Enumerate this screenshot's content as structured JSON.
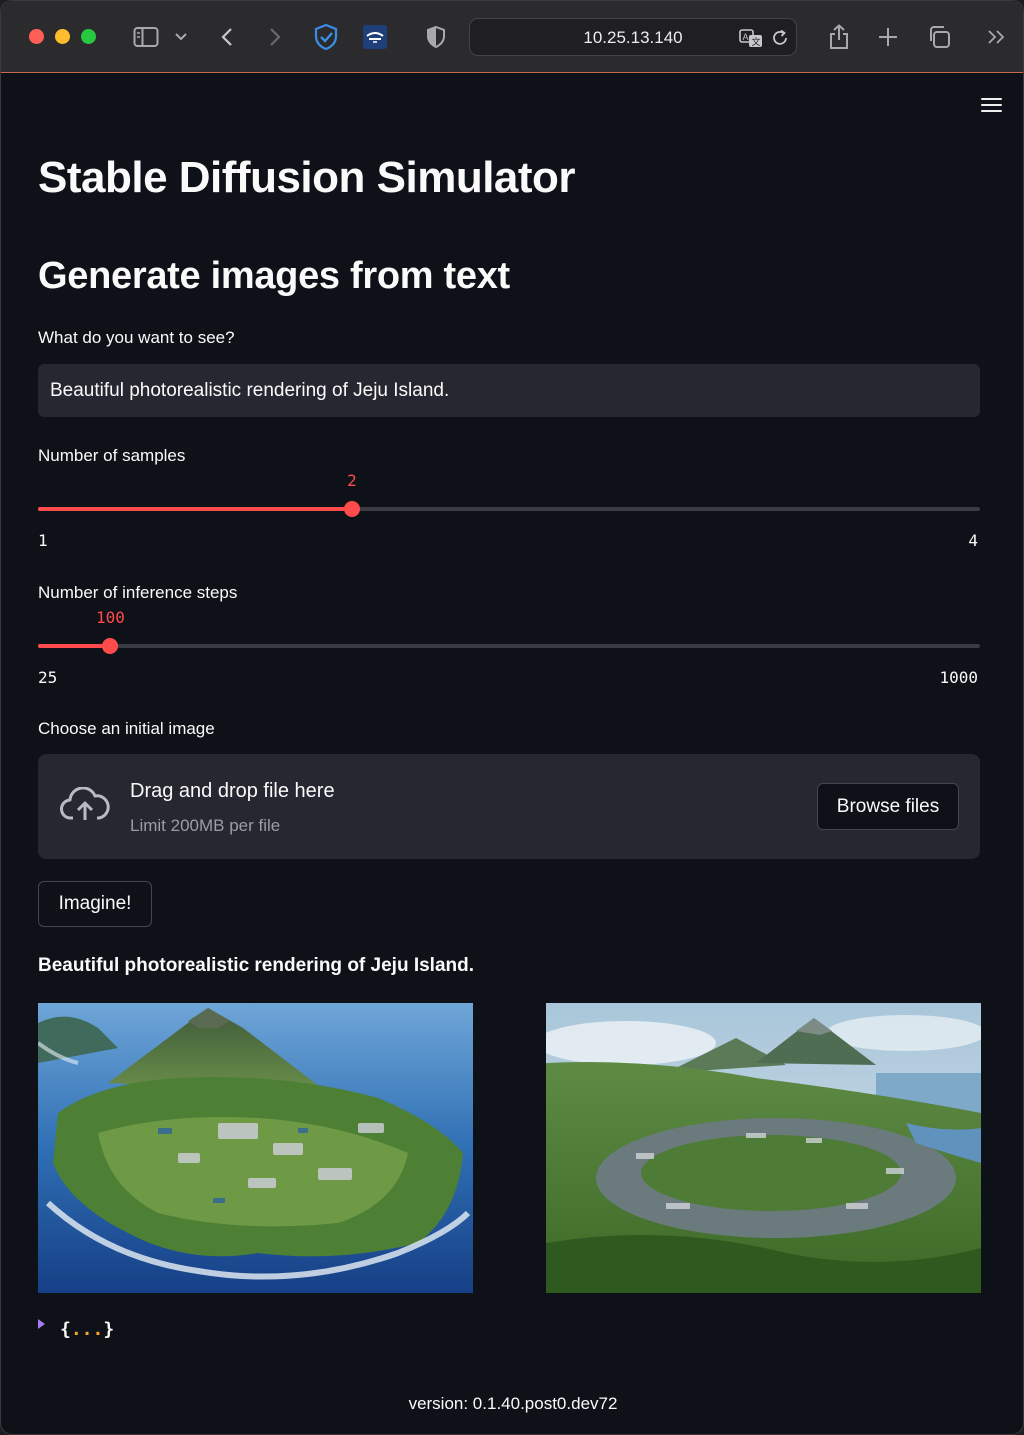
{
  "browser": {
    "url": "10.25.13.140"
  },
  "app": {
    "title": "Stable Diffusion Simulator",
    "subtitle": "Generate images from text",
    "prompt": {
      "label": "What do you want to see?",
      "value": "Beautiful photorealistic rendering of Jeju Island."
    },
    "samples_slider": {
      "label": "Number of samples",
      "value": 2,
      "value_text": "2",
      "min": 1,
      "max": 4,
      "min_text": "1",
      "max_text": "4"
    },
    "steps_slider": {
      "label": "Number of inference steps",
      "value": 100,
      "value_text": "100",
      "min": 25,
      "max": 1000,
      "min_text": "25",
      "max_text": "1000"
    },
    "uploader": {
      "label": "Choose an initial image",
      "title": "Drag and drop file here",
      "subtitle": "Limit 200MB per file",
      "button": "Browse files"
    },
    "imagine_button": "Imagine!",
    "result": {
      "caption": "Beautiful photorealistic rendering of Jeju Island.",
      "images": [
        "generated-image-1",
        "generated-image-2"
      ]
    },
    "json_viewer": {
      "open": "{",
      "dots": "...",
      "close": "}"
    },
    "footer": "version: 0.1.40.post0.dev72"
  },
  "colors": {
    "accent": "#ff4b4b",
    "background": "#0e1117",
    "widget": "#262730"
  }
}
